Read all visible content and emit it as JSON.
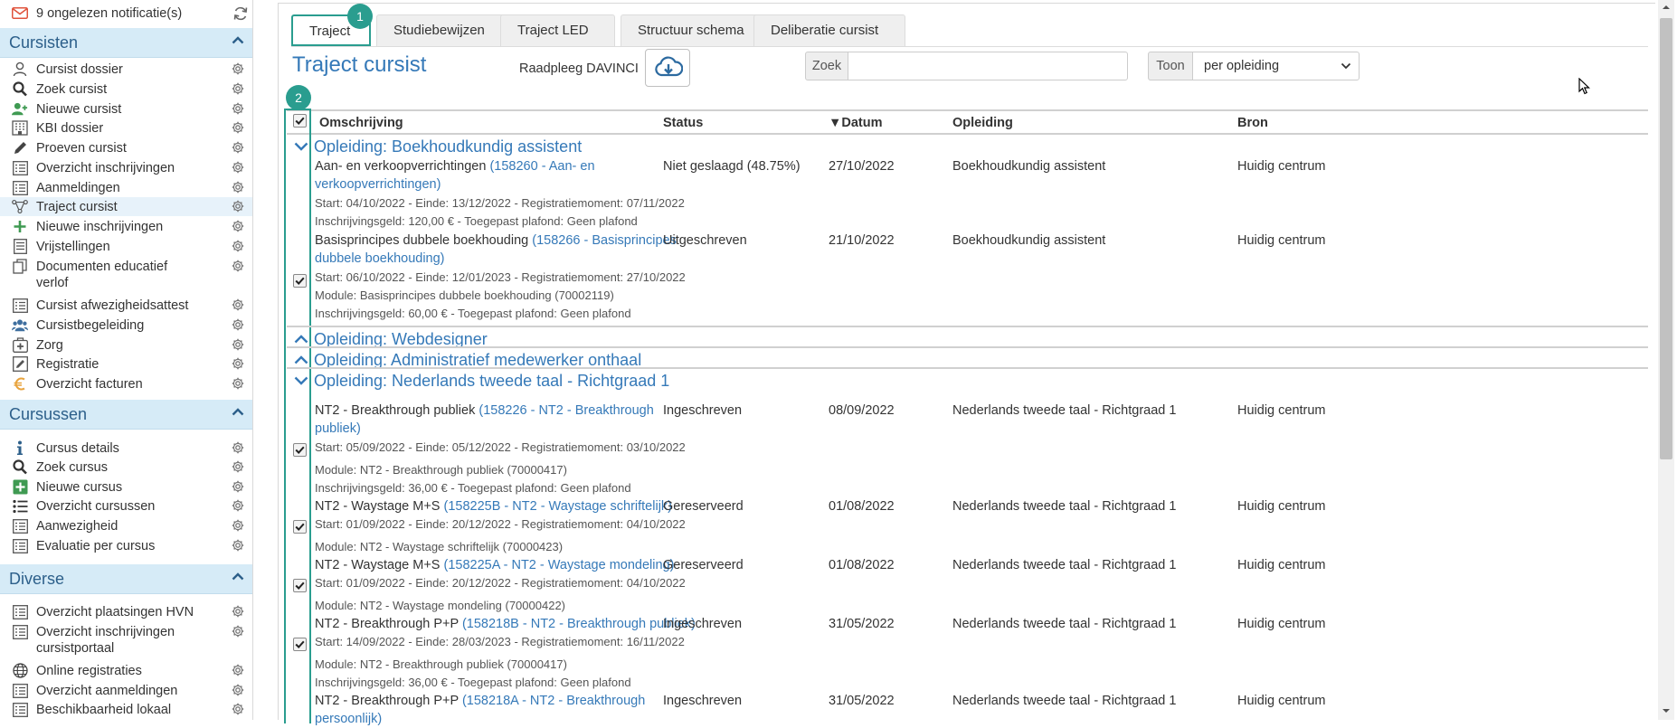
{
  "notifications": {
    "text": "9 ongelezen notificatie(s)"
  },
  "sidebar": {
    "sections": [
      {
        "title": "Cursisten",
        "items": [
          {
            "label": "Cursist dossier",
            "icon": "user-icon"
          },
          {
            "label": "Zoek cursist",
            "icon": "search-icon"
          },
          {
            "label": "Nieuwe cursist",
            "icon": "user-add-icon"
          },
          {
            "label": "KBI dossier",
            "icon": "building-icon"
          },
          {
            "label": "Proeven cursist",
            "icon": "pencil-icon"
          },
          {
            "label": "Overzicht inschrijvingen",
            "icon": "list-icon"
          },
          {
            "label": "Aanmeldingen",
            "icon": "list-icon"
          },
          {
            "label": "Traject cursist",
            "icon": "route-icon",
            "active": true
          },
          {
            "label": "Nieuwe inschrijvingen",
            "icon": "plus-icon"
          },
          {
            "label": "Vrijstellingen",
            "icon": "document-list-icon"
          },
          {
            "label": "Documenten educatief",
            "label2": "verlof",
            "icon": "copy-icon"
          },
          {
            "label": "Cursist afwezigheidsattest",
            "icon": "list-icon"
          },
          {
            "label": "Cursistbegeleiding",
            "icon": "users-icon"
          },
          {
            "label": "Zorg",
            "icon": "medkit-icon"
          },
          {
            "label": "Registratie",
            "icon": "edit-box-icon"
          },
          {
            "label": "Overzicht facturen",
            "icon": "euro-icon"
          }
        ]
      },
      {
        "title": "Cursussen",
        "items": [
          {
            "label": "Cursus details",
            "icon": "info-icon"
          },
          {
            "label": "Zoek cursus",
            "icon": "search-icon"
          },
          {
            "label": "Nieuwe cursus",
            "icon": "plus-box-icon"
          },
          {
            "label": "Overzicht cursussen",
            "icon": "bullet-list-icon"
          },
          {
            "label": "Aanwezigheid",
            "icon": "list-icon"
          },
          {
            "label": "Evaluatie per cursus",
            "icon": "list-icon"
          }
        ]
      },
      {
        "title": "Diverse",
        "items": [
          {
            "label": "Overzicht plaatsingen HVN",
            "icon": "list-icon"
          },
          {
            "label": "Overzicht inschrijvingen",
            "label2": "cursistportaal",
            "icon": "list-icon"
          },
          {
            "label": "Online registraties",
            "icon": "globe-icon"
          },
          {
            "label": "Overzicht aanmeldingen",
            "icon": "list-icon"
          },
          {
            "label": "Beschikbaarheid lokaal",
            "icon": "list-icon"
          }
        ]
      }
    ]
  },
  "tabs": [
    "Traject",
    "Studiebewijzen",
    "Traject LED",
    "Structuur schema",
    "Deliberatie cursist"
  ],
  "badges": [
    "1",
    "2"
  ],
  "page": {
    "title": "Traject cursist",
    "raadpleeg_label": "Raadpleeg DAVINCI",
    "zoek_label": "Zoek",
    "zoek_value": "",
    "toon_label": "Toon",
    "toon_value": "per opleiding"
  },
  "table": {
    "headers": {
      "omschrijving": "Omschrijving",
      "status": "Status",
      "datum": "▼Datum",
      "opleiding": "Opleiding",
      "bron": "Bron"
    },
    "groups": [
      {
        "title": "Opleiding: Boekhoudkundig assistent",
        "expanded": true
      },
      {
        "title": "Opleiding: Webdesigner",
        "expanded": false
      },
      {
        "title": "Opleiding: Administratief medewerker onthaal",
        "expanded": false
      },
      {
        "title": "Opleiding: Nederlands tweede taal - Richtgraad 1",
        "expanded": true
      }
    ],
    "rows": [
      {
        "name": "Aan- en verkoopverrichtingen",
        "link1": "(158260 - Aan- en",
        "link2": "verkoopverrichtingen)",
        "line1": "Start: 04/10/2022 - Einde: 13/12/2022 - Registratiemoment: 07/11/2022",
        "line2": "Inschrijvingsgeld: 120,00 € - Toegepast plafond: Geen plafond",
        "line3": "",
        "status": "Niet geslaagd (48.75%)",
        "datum": "27/10/2022",
        "opleiding": "Boekhoudkundig assistent",
        "bron": "Huidig centrum",
        "checked": false
      },
      {
        "name": "Basisprincipes dubbele boekhouding",
        "link1": "(158266 - Basisprincipes",
        "link2": "dubbele boekhouding)",
        "line1": "Start: 06/10/2022 - Einde: 12/01/2023 - Registratiemoment: 27/10/2022",
        "line2": "Module: Basisprincipes dubbele boekhouding (70002119)",
        "line3": "Inschrijvingsgeld: 60,00 € - Toegepast plafond: Geen plafond",
        "status": "Uitgeschreven",
        "datum": "21/10/2022",
        "opleiding": "Boekhoudkundig assistent",
        "bron": "Huidig centrum",
        "checked": true
      },
      {
        "name": "NT2 - Breakthrough publiek",
        "link1": "(158226 - NT2 - Breakthrough",
        "link2": "publiek)",
        "line1": "Start: 05/09/2022 - Einde: 05/12/2022 - Registratiemoment: 03/10/2022",
        "line2": "Module: NT2 - Breakthrough publiek (70000417)",
        "line3": "Inschrijvingsgeld: 36,00 € - Toegepast plafond: Geen plafond",
        "status": "Ingeschreven",
        "datum": "08/09/2022",
        "opleiding": "Nederlands tweede taal - Richtgraad 1",
        "bron": "Huidig centrum",
        "checked": true
      },
      {
        "name": "NT2 - Waystage M+S",
        "link1": "(158225B - NT2 - Waystage schriftelijk)",
        "link2": "",
        "line1": "Start: 01/09/2022 - Einde: 20/12/2022 - Registratiemoment: 04/10/2022",
        "line2": "Module: NT2 - Waystage schriftelijk (70000423)",
        "line3": "",
        "status": "Gereserveerd",
        "datum": "01/08/2022",
        "opleiding": "Nederlands tweede taal - Richtgraad 1",
        "bron": "Huidig centrum",
        "checked": true
      },
      {
        "name": "NT2 - Waystage M+S",
        "link1": "(158225A - NT2 - Waystage mondeling)",
        "link2": "",
        "line1": "Start: 01/09/2022 - Einde: 20/12/2022 - Registratiemoment: 04/10/2022",
        "line2": "Module: NT2 - Waystage mondeling (70000422)",
        "line3": "",
        "status": "Gereserveerd",
        "datum": "01/08/2022",
        "opleiding": "Nederlands tweede taal - Richtgraad 1",
        "bron": "Huidig centrum",
        "checked": true
      },
      {
        "name": "NT2 - Breakthrough P+P",
        "link1": "(158218B - NT2 - Breakthrough publiek)",
        "link2": "",
        "line1": "Start: 14/09/2022 - Einde: 28/03/2023 - Registratiemoment: 16/11/2022",
        "line2": "Module: NT2 - Breakthrough publiek (70000417)",
        "line3": "Inschrijvingsgeld: 36,00 € - Toegepast plafond: Geen plafond",
        "status": "Ingeschreven",
        "datum": "31/05/2022",
        "opleiding": "Nederlands tweede taal - Richtgraad 1",
        "bron": "Huidig centrum",
        "checked": true
      },
      {
        "name": "NT2 - Breakthrough P+P",
        "link1": "(158218A - NT2 - Breakthrough",
        "link2": "persoonlijk)",
        "line1": "",
        "line2": "",
        "line3": "",
        "status": "Ingeschreven",
        "datum": "31/05/2022",
        "opleiding": "Nederlands tweede taal - Richtgraad 1",
        "bron": "Huidig centrum",
        "checked": false
      }
    ]
  },
  "colors": {
    "accent": "#2a9d8f",
    "link": "#3579b8",
    "section_bg": "#d6ebf7",
    "mail_icon": "#e0533c"
  }
}
